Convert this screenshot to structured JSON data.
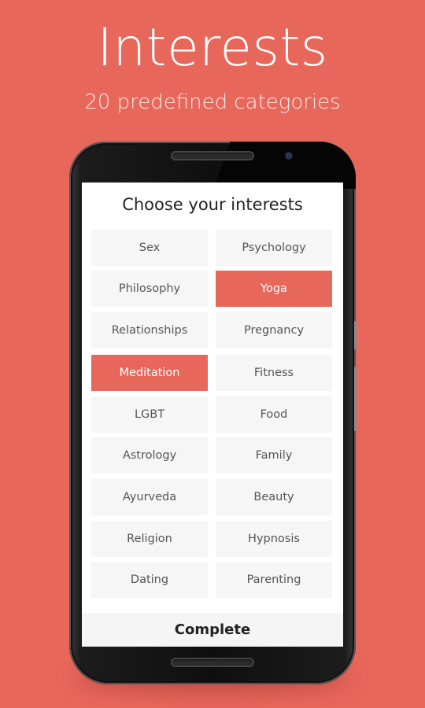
{
  "promo": {
    "title": "Interests",
    "subtitle": "20 predefined categories"
  },
  "screen": {
    "title": "Choose your interests",
    "interests": [
      {
        "label": "Sex",
        "selected": false
      },
      {
        "label": "Psychology",
        "selected": false
      },
      {
        "label": "Philosophy",
        "selected": false
      },
      {
        "label": "Yoga",
        "selected": true
      },
      {
        "label": "Relationships",
        "selected": false
      },
      {
        "label": "Pregnancy",
        "selected": false
      },
      {
        "label": "Meditation",
        "selected": true
      },
      {
        "label": "Fitness",
        "selected": false
      },
      {
        "label": "LGBT",
        "selected": false
      },
      {
        "label": "Food",
        "selected": false
      },
      {
        "label": "Astrology",
        "selected": false
      },
      {
        "label": "Family",
        "selected": false
      },
      {
        "label": "Ayurveda",
        "selected": false
      },
      {
        "label": "Beauty",
        "selected": false
      },
      {
        "label": "Religion",
        "selected": false
      },
      {
        "label": "Hypnosis",
        "selected": false
      },
      {
        "label": "Dating",
        "selected": false
      },
      {
        "label": "Parenting",
        "selected": false
      }
    ],
    "complete_label": "Complete"
  },
  "colors": {
    "accent": "#e8675b",
    "chip_bg": "#f6f6f6",
    "chip_text": "#555555",
    "selected_text": "#ffffff"
  }
}
